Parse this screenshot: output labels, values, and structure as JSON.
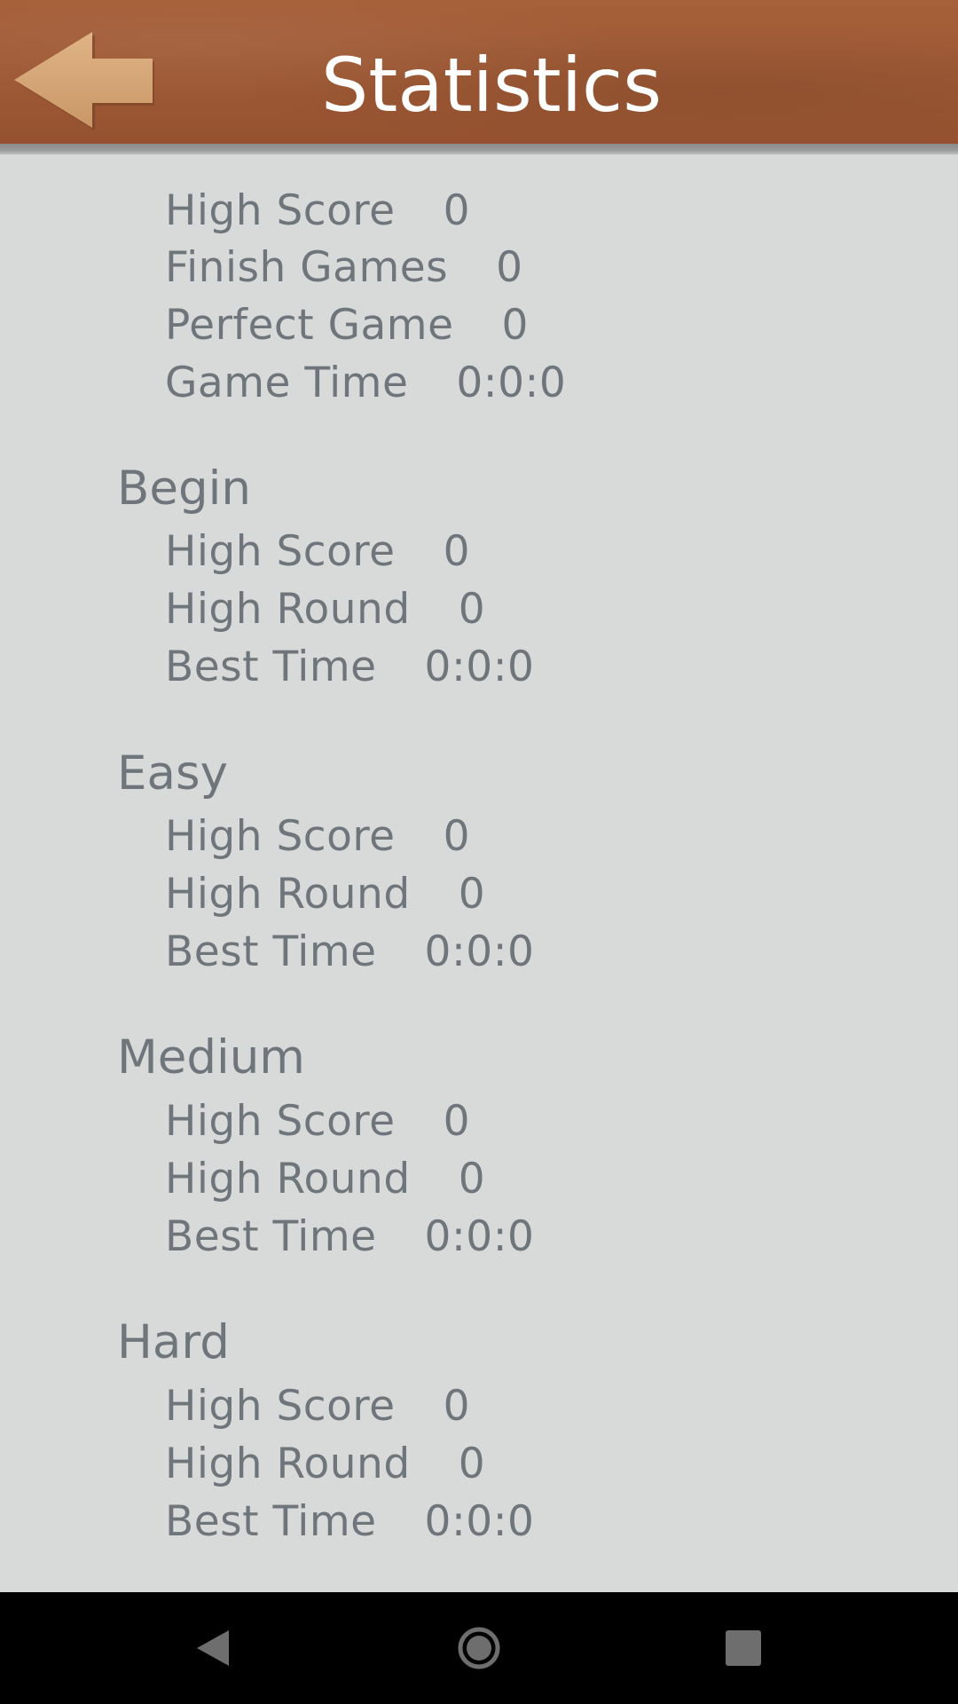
{
  "header": {
    "title": "Statistics",
    "back_icon": "back-arrow-icon",
    "colors": {
      "bar": "#9d5834",
      "arrow": "#d7a879",
      "title": "#ffffff"
    }
  },
  "overall": {
    "rows": [
      {
        "label": "High Score",
        "value": "0"
      },
      {
        "label": "Finish Games",
        "value": "0"
      },
      {
        "label": "Perfect Game",
        "value": "0"
      },
      {
        "label": "Game Time",
        "value": "0:0:0"
      }
    ]
  },
  "sections": [
    {
      "title": "Begin",
      "rows": [
        {
          "label": "High Score",
          "value": "0"
        },
        {
          "label": "High Round",
          "value": "0"
        },
        {
          "label": "Best Time",
          "value": "0:0:0"
        }
      ]
    },
    {
      "title": "Easy",
      "rows": [
        {
          "label": "High Score",
          "value": "0"
        },
        {
          "label": "High Round",
          "value": "0"
        },
        {
          "label": "Best Time",
          "value": "0:0:0"
        }
      ]
    },
    {
      "title": "Medium",
      "rows": [
        {
          "label": "High Score",
          "value": "0"
        },
        {
          "label": "High Round",
          "value": "0"
        },
        {
          "label": "Best Time",
          "value": "0:0:0"
        }
      ]
    },
    {
      "title": "Hard",
      "rows": [
        {
          "label": "High Score",
          "value": "0"
        },
        {
          "label": "High Round",
          "value": "0"
        },
        {
          "label": "Best Time",
          "value": "0:0:0"
        }
      ]
    }
  ],
  "navbar": {
    "icons": [
      "nav-back-icon",
      "nav-home-icon",
      "nav-recents-icon"
    ],
    "color": "#6e6e6e"
  }
}
